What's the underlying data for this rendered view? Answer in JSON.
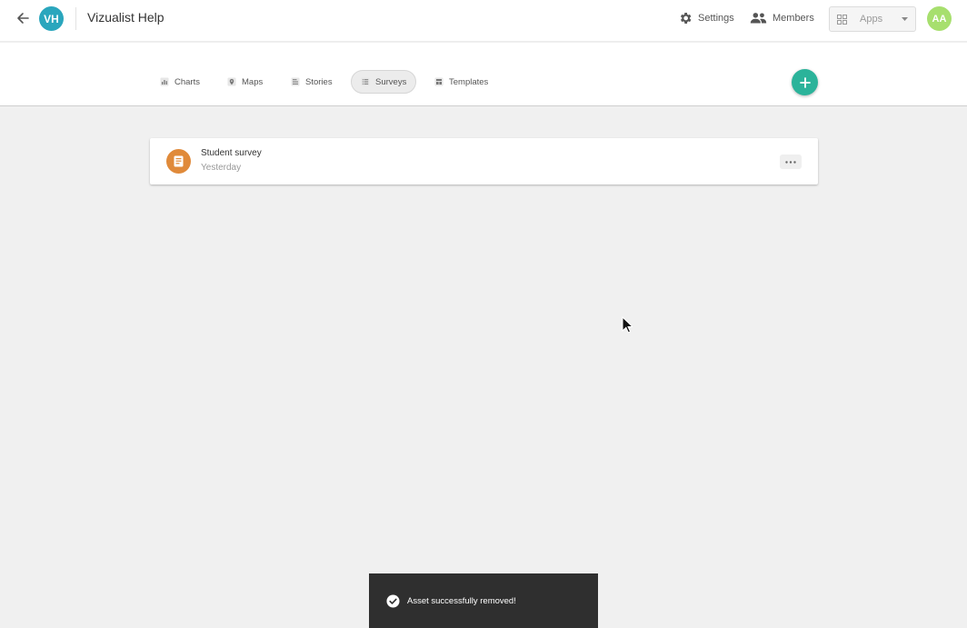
{
  "colors": {
    "workspace_avatar": "#2aa6bd",
    "user_avatar": "#a7df6e",
    "add_button": "#2bb39a",
    "survey_icon": "#e08a3a",
    "toast_bg": "#2f2f2f"
  },
  "header": {
    "back_icon": "arrow-left-icon",
    "workspace_initials": "VH",
    "workspace_title": "Vizualist Help",
    "settings_label": "Settings",
    "members_label": "Members",
    "apps_label": "Apps",
    "user_initials": "AA"
  },
  "tabs": [
    {
      "label": "Charts",
      "icon": "bar-chart-icon",
      "active": false
    },
    {
      "label": "Maps",
      "icon": "map-pin-icon",
      "active": false
    },
    {
      "label": "Stories",
      "icon": "document-lines-icon",
      "active": false
    },
    {
      "label": "Surveys",
      "icon": "list-icon",
      "active": true
    },
    {
      "label": "Templates",
      "icon": "template-icon",
      "active": false
    }
  ],
  "assets": [
    {
      "name": "Student survey",
      "date": "Yesterday",
      "icon": "survey-doc-icon"
    }
  ],
  "toast": {
    "icon": "check-circle-icon",
    "message": "Asset successfully removed!"
  }
}
